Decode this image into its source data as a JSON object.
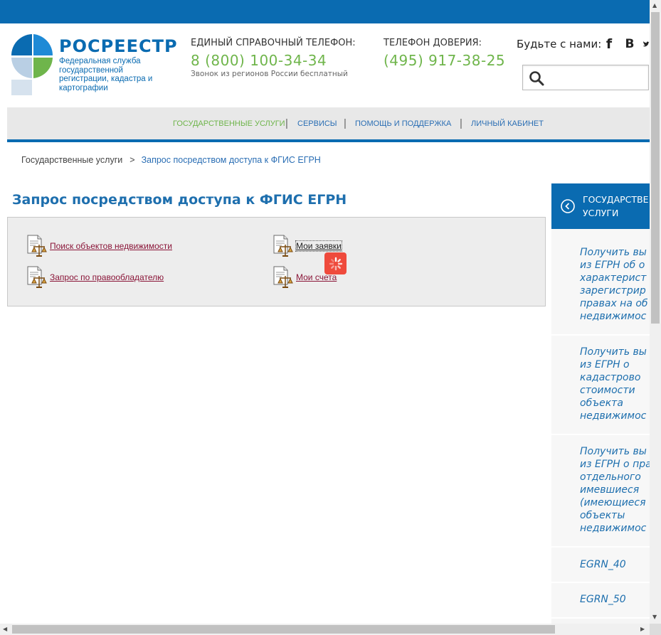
{
  "header": {
    "logo_name": "РОСРЕЕСТР",
    "logo_sub": "Федеральная служба государственной регистрации, кадастра и картографии",
    "phone_label": "ЕДИНЫЙ СПРАВОЧНЫЙ ТЕЛЕФОН:",
    "phone_number": "8 (800) 100-34-34",
    "phone_note": "Звонок из регионов России бесплатный",
    "trust_label": "ТЕЛЕФОН ДОВЕРИЯ:",
    "trust_number": "(495) 917-38-25",
    "social_label": "Будьте с нами:",
    "social": [
      "f",
      "B"
    ],
    "search_placeholder": ""
  },
  "nav": {
    "items": [
      {
        "label": "ГОСУДАРСТВЕННЫЕ УСЛУГИ",
        "active": true
      },
      {
        "label": "СЕРВИСЫ",
        "active": false
      },
      {
        "label": "ПОМОЩЬ И ПОДДЕРЖКА",
        "active": false
      },
      {
        "label": "ЛИЧНЫЙ КАБИНЕТ",
        "active": false
      }
    ],
    "separator": "|"
  },
  "breadcrumb": {
    "home": "Государственные услуги",
    "separator": ">",
    "current": "Запрос посредством доступа к ФГИС ЕГРН"
  },
  "main": {
    "title": "Запрос посредством доступа к ФГИС ЕГРН",
    "links": [
      {
        "label": "Поиск объектов недвижимости"
      },
      {
        "label": "Мои заявки"
      },
      {
        "label": "Запрос по правообладателю"
      },
      {
        "label": "Мои счета"
      }
    ]
  },
  "sidebar": {
    "header": [
      "ГОСУДАРСТВЕ",
      "УСЛУГИ"
    ],
    "items": [
      {
        "lines": [
          "Получить вы",
          "из ЕГРН об о",
          "характерист",
          "зарегистрир",
          "правах на об",
          "недвижимос"
        ]
      },
      {
        "lines": [
          "Получить вы",
          "из ЕГРН о",
          "кадастрово",
          "стоимости",
          "объекта",
          "недвижимос"
        ]
      },
      {
        "lines": [
          "Получить вы",
          "из ЕГРН о пра",
          "отдельного",
          "имевшиеся",
          "(имеющиеся",
          "объекты",
          "недвижимос"
        ]
      },
      {
        "lines": [
          "EGRN_40"
        ]
      },
      {
        "lines": [
          "EGRN_50"
        ]
      }
    ]
  },
  "colors": {
    "brand_blue": "#0a6bb1",
    "accent_green": "#6fb54b",
    "link_maroon": "#8a1538",
    "spinner_red": "#ef4a3c"
  }
}
